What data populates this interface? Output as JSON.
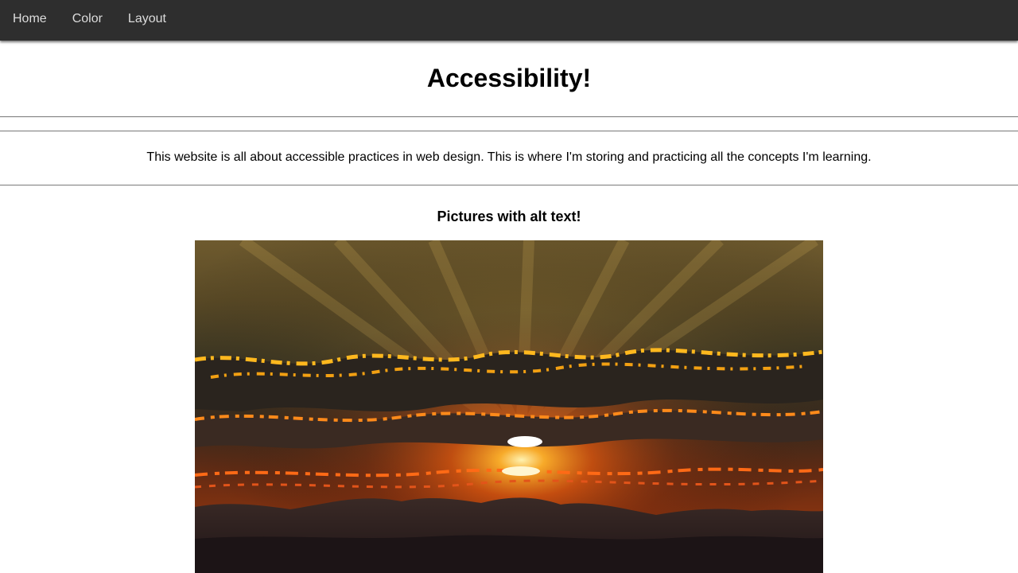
{
  "nav": {
    "items": [
      {
        "label": "Home"
      },
      {
        "label": "Color"
      },
      {
        "label": "Layout"
      }
    ]
  },
  "header": {
    "title": "Accessibility!"
  },
  "intro": {
    "text": "This website is all about accessible practices in web design. This is where I'm storing and practicing all the concepts I'm learning."
  },
  "pictures": {
    "heading": "Pictures with alt text!",
    "image_subject": "sunset-over-mountains"
  },
  "colors": {
    "navbar_bg": "#2e2e2e",
    "nav_text": "#dcdcdc",
    "rule": "#8a8a8a"
  }
}
